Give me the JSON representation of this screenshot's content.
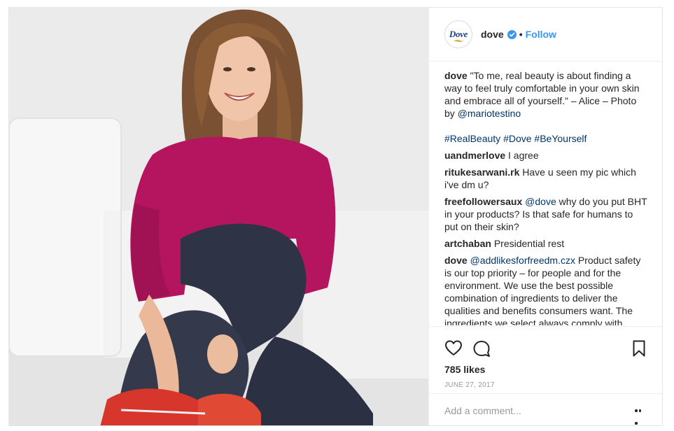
{
  "post": {
    "author": "dove",
    "avatar_text": "Dove",
    "separator": "•",
    "follow_label": "Follow",
    "caption": {
      "user": "dove",
      "text": "\"To me, real beauty is about finding a way to feel truly comfortable in your own skin and embrace all of yourself.\" – Alice – Photo by ",
      "mention": "@mariotestino",
      "hashtags": [
        "#RealBeauty",
        "#Dove",
        "#BeYourself"
      ]
    },
    "comments": [
      {
        "user": "uandmerlove",
        "text": "I agree"
      },
      {
        "user": "ritukesarwani.rk",
        "text": "Have u seen my pic which i've dm u?"
      },
      {
        "user": "freefollowersaux",
        "mention": "@dove",
        "text": " why do you put BHT in your products? Is that safe for humans to put on their skin?"
      },
      {
        "user": "artchaban",
        "text": "Presidential rest"
      },
      {
        "user": "dove",
        "mention": "@addlikesforfreedm.czx",
        "text": " Product safety is our top priority – for people and for the environment. We use the best possible combination of ingredients to deliver the qualities and benefits consumers want. The ingredients we select always comply with"
      }
    ],
    "likes": "785 likes",
    "date": "JUNE 27, 2017",
    "comment_placeholder": "Add a comment..."
  },
  "icons": {
    "like": "heart-icon",
    "comment": "speech-bubble-icon",
    "save": "bookmark-icon",
    "verified": "verified-badge-icon",
    "more": "more-options-icon"
  },
  "colors": {
    "link": "#3897f0",
    "hashtag": "#003569",
    "text": "#262626",
    "muted": "#999999",
    "sweater": "#b5145f"
  }
}
